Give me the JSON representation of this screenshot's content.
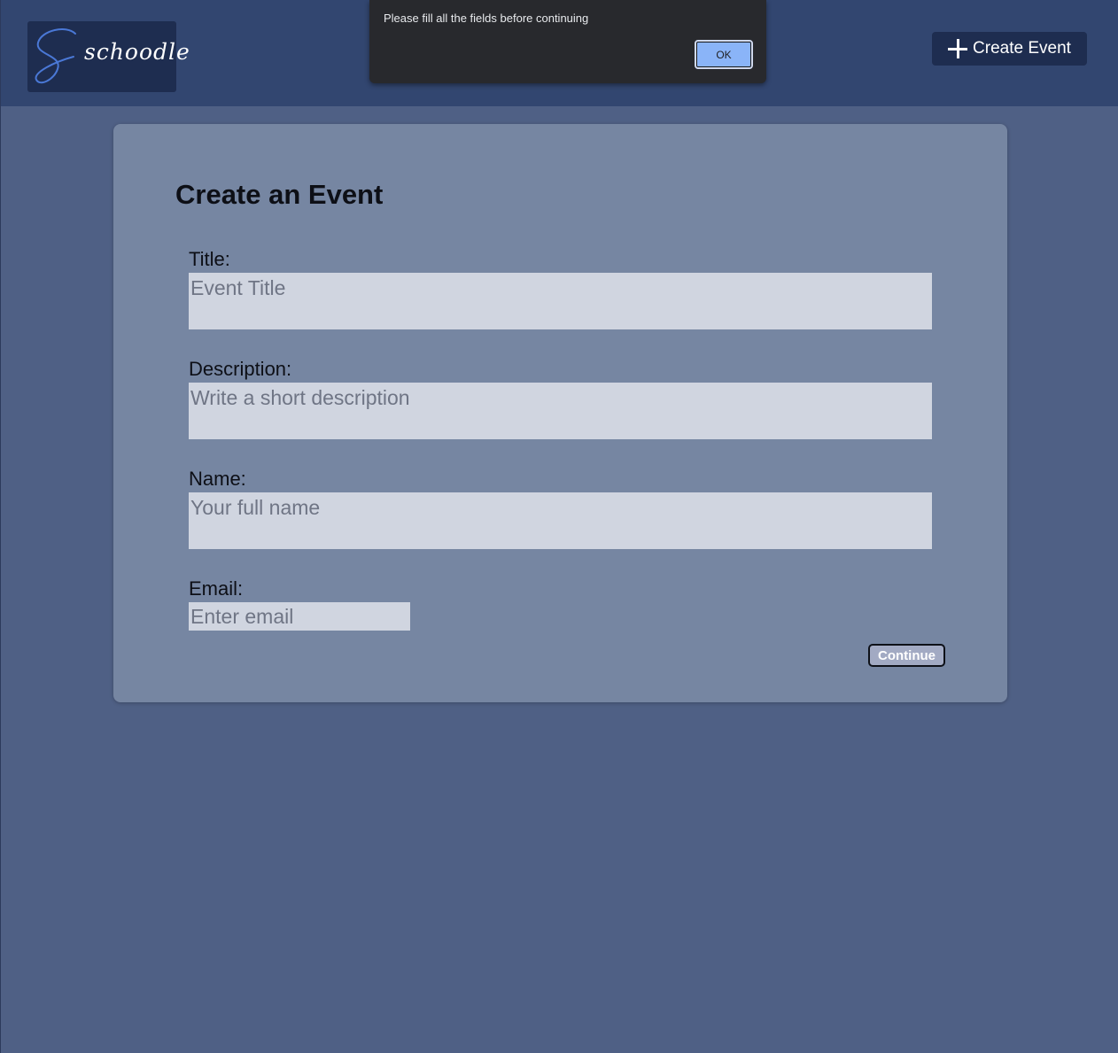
{
  "header": {
    "logo_text": "schoodle",
    "create_event_label": "Create Event"
  },
  "alert": {
    "message": "Please fill all the fields before continuing",
    "ok_label": "OK"
  },
  "form": {
    "title": "Create an Event",
    "fields": {
      "title": {
        "label": "Title:",
        "placeholder": "Event Title",
        "value": ""
      },
      "description": {
        "label": "Description:",
        "placeholder": "Write a short description",
        "value": ""
      },
      "name": {
        "label": "Name:",
        "placeholder": "Your full name",
        "value": ""
      },
      "email": {
        "label": "Email:",
        "placeholder": "Enter email",
        "value": ""
      }
    },
    "continue_label": "Continue"
  },
  "colors": {
    "header_bg": "#324670",
    "page_bg": "#4f6085",
    "card_bg": "#7686a2",
    "input_bg": "#d0d5e0",
    "logo_accent": "#4a78d6",
    "ok_button": "#8ab4f8"
  },
  "icons": {
    "logo": "script-s-logo-icon",
    "create": "plus-icon"
  }
}
